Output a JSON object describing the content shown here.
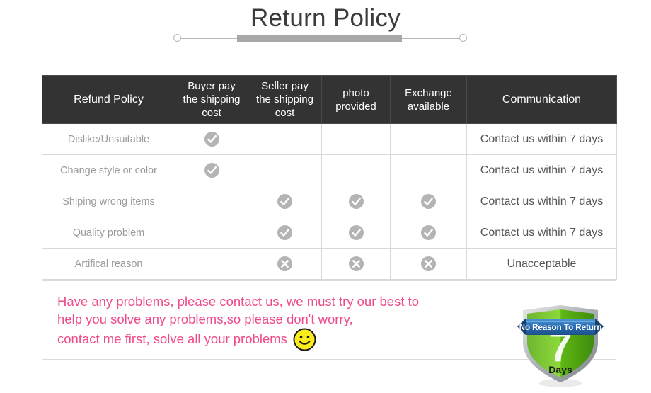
{
  "header": {
    "title": "Return Policy",
    "divider_icon_left": "circle-endpoint-icon",
    "divider_icon_right": "circle-endpoint-icon",
    "accent_color": "#a8a8a8"
  },
  "table": {
    "columns": [
      "Refund Policy",
      "Buyer pay the shipping cost",
      "Seller pay the shipping cost",
      "photo provided",
      "Exchange available",
      "Communication"
    ],
    "column_lines": [
      [
        "Refund Policy"
      ],
      [
        "Buyer pay",
        "the shipping",
        "cost"
      ],
      [
        "Seller pay",
        "the shipping",
        "cost"
      ],
      [
        "photo",
        "provided"
      ],
      [
        "Exchange",
        "available"
      ],
      [
        "Communication"
      ]
    ],
    "header_bg": "#333333",
    "header_text_color": "#ffffff",
    "border_color": "#d8d8d8",
    "rows": [
      {
        "label": "Dislike/Unsuitable",
        "buyer_pay": "check",
        "seller_pay": "",
        "photo": "",
        "exchange": "",
        "communication": "Contact us within 7 days"
      },
      {
        "label": "Change style or color",
        "buyer_pay": "check",
        "seller_pay": "",
        "photo": "",
        "exchange": "",
        "communication": "Contact us within 7 days"
      },
      {
        "label": "Shiping wrong items",
        "buyer_pay": "",
        "seller_pay": "check",
        "photo": "check",
        "exchange": "check",
        "communication": "Contact us within 7 days"
      },
      {
        "label": "Quality problem",
        "buyer_pay": "",
        "seller_pay": "check",
        "photo": "check",
        "exchange": "check",
        "communication": "Contact us within 7 days"
      },
      {
        "label": "Artifical reason",
        "buyer_pay": "",
        "seller_pay": "cross",
        "photo": "cross",
        "exchange": "cross",
        "communication": "Unacceptable"
      }
    ],
    "icons": {
      "check": "check-circle-icon",
      "cross": "cross-circle-icon",
      "icon_color": "#b4b4b4"
    }
  },
  "note": {
    "lines": [
      "Have any problems, please contact us, we must try our best to",
      "help you solve any problems,so please don't worry,",
      "contact me first, solve all your problems"
    ],
    "text_color": "#ef4a8b",
    "emoji": "smiley-face-icon"
  },
  "badge": {
    "ribbon_text": "No Reason To Return",
    "number": "7",
    "unit": "Days",
    "shield_color": "#66c21a",
    "ribbon_color": "#2b6fb5"
  }
}
